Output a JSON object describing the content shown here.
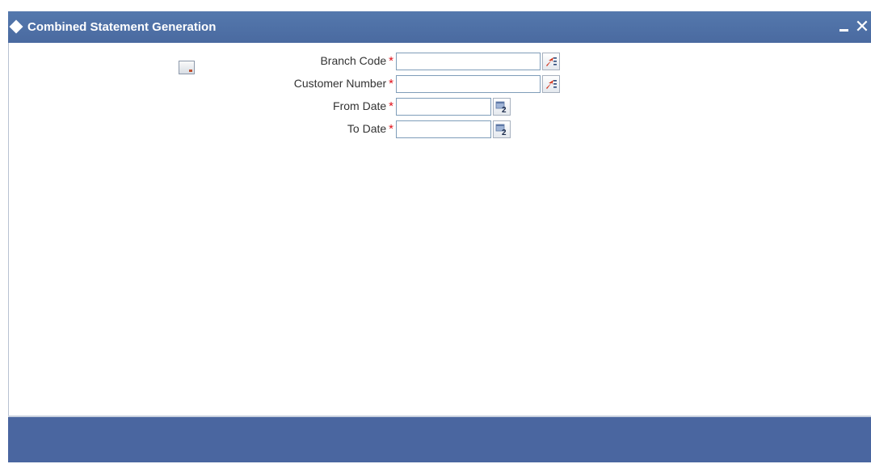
{
  "window": {
    "title": "Combined Statement Generation",
    "minimize_icon": "minimize-icon",
    "close_icon": "close-icon"
  },
  "form": {
    "fields": [
      {
        "label": "Branch Code",
        "required_mark": "*",
        "value": "",
        "button_icon": "list-of-values-icon"
      },
      {
        "label": "Customer Number",
        "required_mark": "*",
        "value": "",
        "button_icon": "list-of-values-icon"
      },
      {
        "label": "From Date",
        "required_mark": "*",
        "value": "",
        "button_icon": "calendar-icon"
      },
      {
        "label": "To Date",
        "required_mark": "*",
        "value": "",
        "button_icon": "calendar-icon"
      }
    ],
    "top_icon": "document-icon"
  },
  "colors": {
    "titlebar": "#5478ad",
    "footer": "#4a66a0",
    "required": "#e0101a"
  }
}
